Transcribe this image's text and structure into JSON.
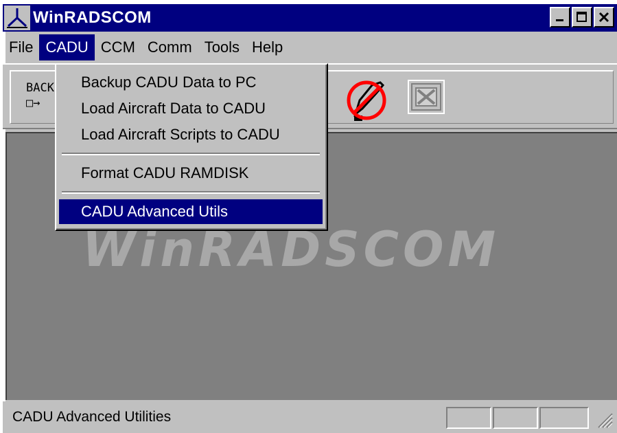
{
  "window": {
    "title": "WinRADSCOM"
  },
  "menubar": {
    "file": "File",
    "cadu": "CADU",
    "ccm": "CCM",
    "comm": "Comm",
    "tools": "Tools",
    "help": "Help"
  },
  "toolbar": {
    "backup_label_1": "BACK",
    "backup_label_2": "□→"
  },
  "dropdown": {
    "items": [
      {
        "label": "Backup CADU Data to PC"
      },
      {
        "label": "Load Aircraft Data to CADU"
      },
      {
        "label": "Load Aircraft Scripts to CADU"
      },
      {
        "label": "Format CADU RAMDISK"
      },
      {
        "label": "CADU Advanced Utils"
      }
    ]
  },
  "workspace": {
    "watermark": "WinRADSCOM"
  },
  "statusbar": {
    "text": "CADU Advanced Utilities"
  },
  "colors": {
    "titlebar": "#000080",
    "selection": "#000080",
    "workspace": "#808080",
    "face": "#c0c0c0"
  }
}
